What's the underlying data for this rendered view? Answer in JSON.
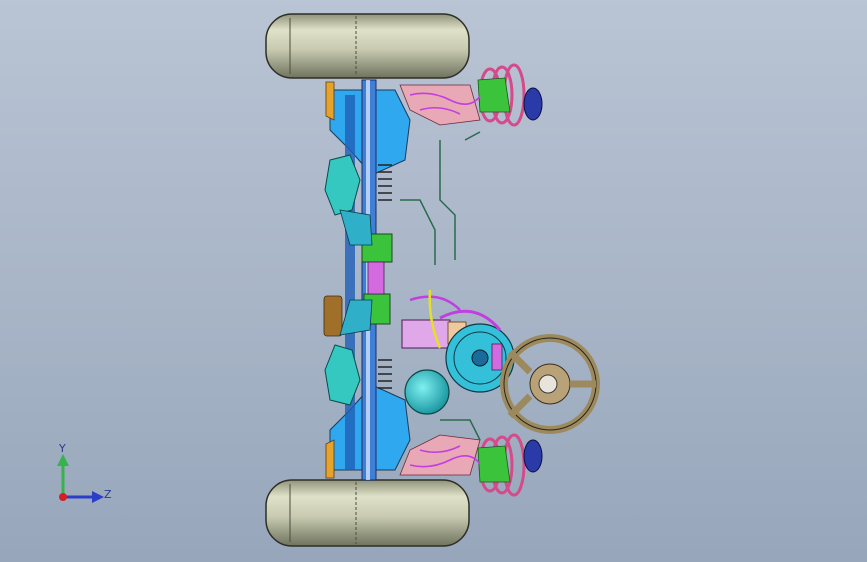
{
  "viewport": {
    "background_top": "#b9c4d4",
    "background_bottom": "#97a6bb"
  },
  "triad": {
    "y_label": "Y",
    "z_label": "Z",
    "y_color": "#36b34a",
    "z_color": "#2b3ec8",
    "x_color": "#d42020"
  },
  "colors": {
    "tire": "#c9ccb0",
    "frame": "#2fa8ef",
    "spring": "#e66a9e",
    "green_part": "#3bc43b",
    "cyan_part": "#34c8c0",
    "magenta_hose": "#c23ee0",
    "orange_part": "#e6a22a",
    "steering_wheel": "#9c8a5e"
  }
}
